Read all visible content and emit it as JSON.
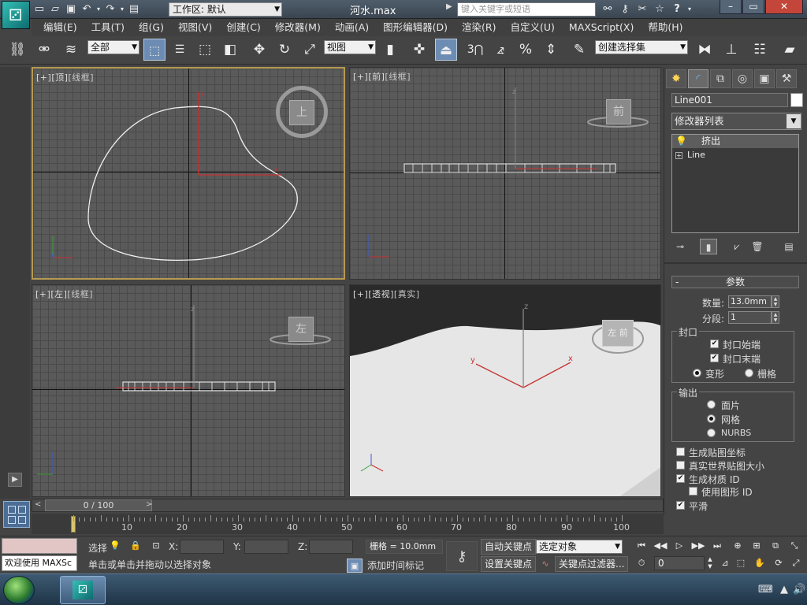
{
  "window": {
    "workspace": "工作区: 默认",
    "title": "河水.max",
    "search_placeholder": "键入关键字或短语",
    "min": "–",
    "max": "▭",
    "close": "✕"
  },
  "menu": [
    "编辑(E)",
    "工具(T)",
    "组(G)",
    "视图(V)",
    "创建(C)",
    "修改器(M)",
    "动画(A)",
    "图形编辑器(D)",
    "渲染(R)",
    "自定义(U)",
    "MAXScript(X)",
    "帮助(H)"
  ],
  "toolbar": {
    "filter": "全部",
    "ref_coord": "视图",
    "snap_3": "3",
    "named_selection": "创建选择集"
  },
  "viewports": {
    "top": {
      "plus": "[+]",
      "view": "[顶]",
      "mode": "[线框]",
      "cube": "上"
    },
    "front": {
      "plus": "[+]",
      "view": "[前]",
      "mode": "[线框]",
      "cube": "前"
    },
    "left": {
      "plus": "[+]",
      "view": "[左]",
      "mode": "[线框]",
      "cube": "左"
    },
    "persp": {
      "plus": "[+]",
      "view": "[透视]",
      "mode": "[真实]",
      "cube": "左 前"
    }
  },
  "axes": {
    "x": "x",
    "y": "y",
    "z": "z"
  },
  "panel": {
    "object_name": "Line001",
    "modifier_list": "修改器列表",
    "stack": [
      {
        "label": "挤出",
        "selected": true
      },
      {
        "label": "Line",
        "selected": false
      }
    ],
    "params_title": "参数",
    "amount_label": "数量:",
    "amount_value": "13.0mm",
    "segments_label": "分段:",
    "segments_value": "1",
    "capping_title": "封口",
    "cap_start": "封口始端",
    "cap_end": "封口末端",
    "morph": "变形",
    "grid": "栅格",
    "output_title": "输出",
    "patch": "面片",
    "mesh": "网格",
    "nurbs": "NURBS",
    "gen_mapping": "生成贴图坐标",
    "real_world": "真实世界贴图大小",
    "gen_matid": "生成材质 ID",
    "use_shape_id": "使用图形 ID",
    "smooth": "平滑"
  },
  "timeline": {
    "slider": "0 / 100",
    "ticks": [
      "10",
      "20",
      "30",
      "40",
      "50",
      "60",
      "70",
      "80",
      "90",
      "100"
    ]
  },
  "status": {
    "welcome": "欢迎使用 MAXSc",
    "selection_label": "选择",
    "x_label": "X:",
    "y_label": "Y:",
    "z_label": "Z:",
    "grid": "栅格 = 10.0mm",
    "auto_key": "自动关键点",
    "selected_object": "选定对象",
    "set_key": "设置关键点",
    "key_filters": "关键点过滤器...",
    "prompt": "单击或单击并拖动以选择对象",
    "add_time_tag": "添加时间标记",
    "frame": "0"
  },
  "colors": {
    "accent": "#b79a52",
    "axis_red": "#c83232",
    "axis_green": "#3ca03c",
    "axis_blue": "#3c5ac8"
  }
}
